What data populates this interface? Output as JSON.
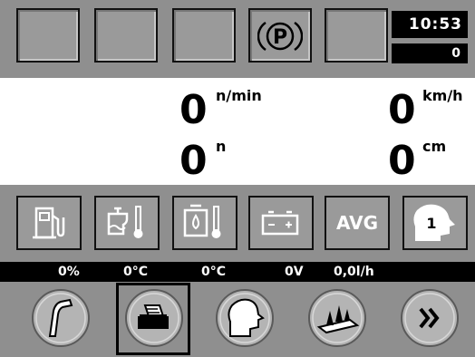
{
  "top": {
    "parking_label": "P",
    "clock_time": "10:53",
    "counter": "0"
  },
  "values": {
    "rpm_value": "0",
    "rpm_unit": "n/min",
    "speed_value": "0",
    "speed_unit": "km/h",
    "count_value": "0",
    "count_unit": "n",
    "distance_value": "0",
    "distance_unit": "cm"
  },
  "icons": {
    "avg_label": "AVG",
    "operator_number": "1"
  },
  "status": {
    "fuel_level": "0%",
    "engine_temp": "0°C",
    "oil_temp": "0°C",
    "voltage": "0V",
    "fuel_rate": "0,0l/h"
  },
  "colors": {
    "panel_gray": "#8f8f8f",
    "box_gray": "#9a9a9a",
    "button_gray": "#b4b4b4",
    "black": "#000000",
    "white": "#ffffff"
  },
  "bottom_buttons": [
    {
      "name": "crane-button",
      "icon": "crane-arm-icon"
    },
    {
      "name": "printer-button",
      "icon": "printer-icon",
      "selected": true
    },
    {
      "name": "operator-button",
      "icon": "operator-head-icon"
    },
    {
      "name": "forest-button",
      "icon": "trees-icon"
    },
    {
      "name": "next-button",
      "icon": "double-chevron-right-icon"
    }
  ]
}
